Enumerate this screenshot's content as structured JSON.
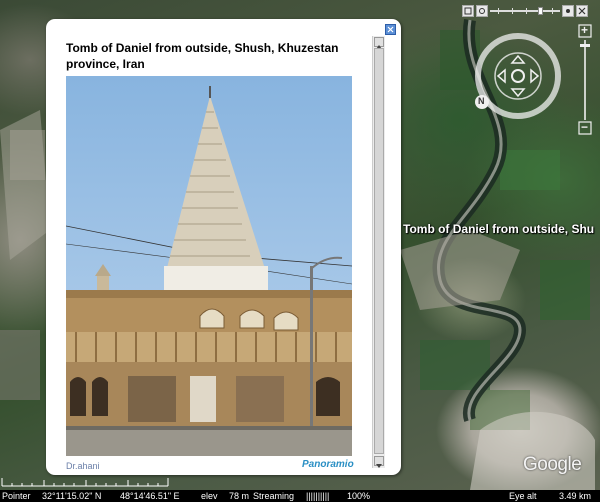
{
  "map": {
    "label": "Tomb of Daniel from outside, Shu",
    "brand": "Google"
  },
  "balloon": {
    "title": "Tomb of Daniel from outside, Shush, Khuzestan province, Iran",
    "credit_left": "Dr.ahani",
    "credit_right": "Panoramio"
  },
  "toolbar": {
    "icons": [
      "view-icon",
      "slider-icon",
      "help-icon",
      "close-icon"
    ]
  },
  "navigation": {
    "north_label": "N",
    "zoom_in": "+",
    "zoom_out": "−"
  },
  "status": {
    "pointer": "Pointer",
    "lat": "32°11'15.02\" N",
    "lon": "48°14'46.51\" E",
    "elev_label": "elev",
    "elev_value": "78 m",
    "streaming_label": "Streaming",
    "streaming_bar": "||||||||||",
    "streaming_pct": "100%",
    "eye_alt_label": "Eye alt",
    "eye_alt_value": "3.49 km"
  },
  "colors": {
    "balloon_bg": "#ffffff",
    "status_bg": "#000000",
    "credit_link": "#2a8fc4"
  }
}
